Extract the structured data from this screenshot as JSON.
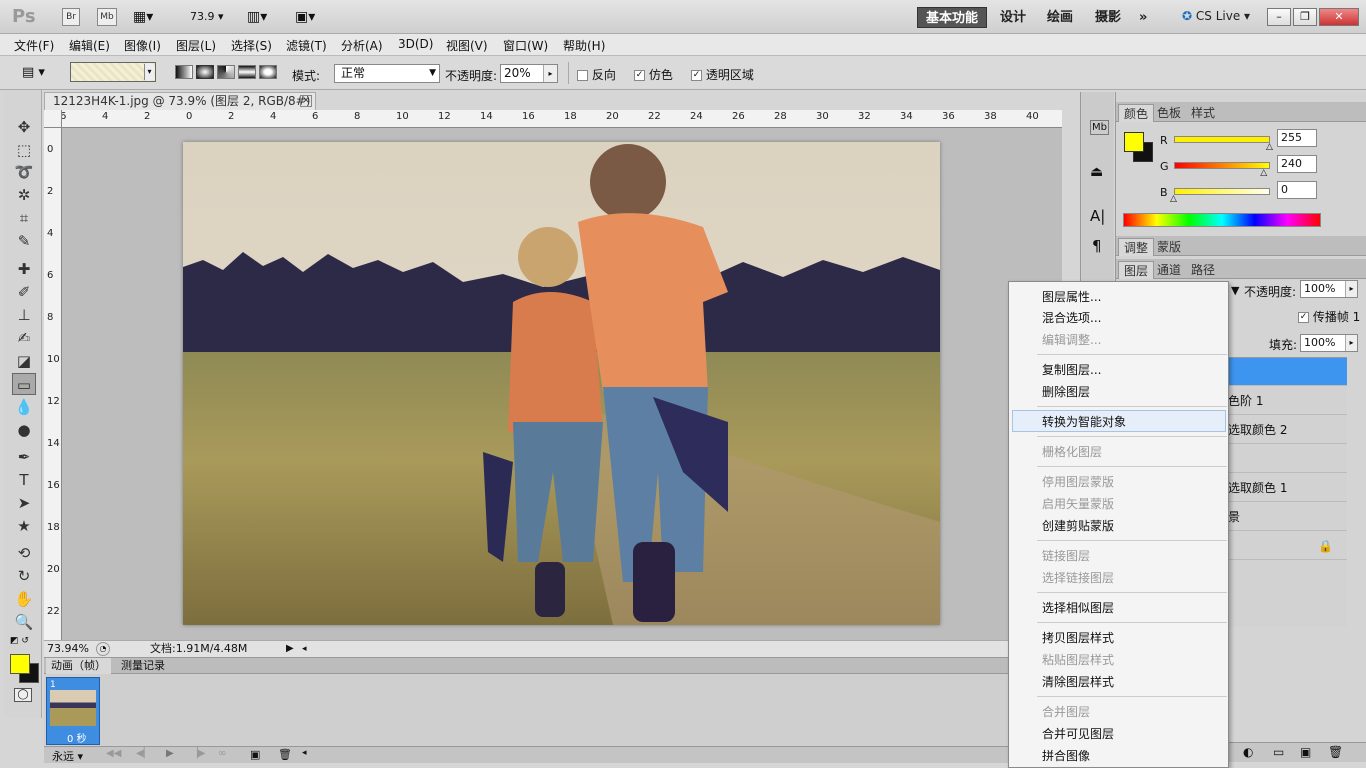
{
  "appbar": {
    "logo": "Ps",
    "br": "Br",
    "mb": "Mb",
    "zoom": "73.9",
    "workspaces": [
      "基本功能",
      "设计",
      "绘画",
      "摄影"
    ],
    "more": "»",
    "cslive": "CS Live"
  },
  "menu": [
    "文件(F)",
    "编辑(E)",
    "图像(I)",
    "图层(L)",
    "选择(S)",
    "滤镜(T)",
    "分析(A)",
    "3D(D)",
    "视图(V)",
    "窗口(W)",
    "帮助(H)"
  ],
  "options": {
    "mode_label": "模式:",
    "mode_value": "正常",
    "opacity_label": "不透明度:",
    "opacity_value": "20%",
    "reverse": "反向",
    "dither": "仿色",
    "transparency": "透明区域"
  },
  "document": {
    "tab_title": "12123H4K-1.jpg @ 73.9% (图层 2, RGB/8#) *",
    "zoom": "73.94%",
    "doc_info": "文档:1.91M/4.48M"
  },
  "ruler": {
    "h": [
      "6",
      "4",
      "2",
      "0",
      "2",
      "4",
      "6",
      "8",
      "10",
      "12",
      "14",
      "16",
      "18",
      "20",
      "22",
      "24",
      "26",
      "28",
      "30",
      "32",
      "34",
      "36",
      "38",
      "40"
    ],
    "v": [
      "0",
      "2",
      "4",
      "6",
      "8",
      "10",
      "12",
      "14",
      "16",
      "18",
      "20",
      "22"
    ]
  },
  "anim": {
    "tabs": [
      "动画（帧）",
      "测量记录"
    ],
    "frame_num": "1",
    "frame_time": "0 秒",
    "loop": "永远"
  },
  "colors": {
    "fg": "#ffff00",
    "bg": "#111111"
  },
  "color_panel": {
    "tabs": [
      "颜色",
      "色板",
      "样式"
    ],
    "r": "255",
    "g": "240",
    "b": "0",
    "r_frac": 1.0,
    "g_frac": 0.94,
    "b_frac": 0.0
  },
  "adjust_panel": {
    "tabs": [
      "调整",
      "蒙版"
    ]
  },
  "layers_panel": {
    "tabs": [
      "图层",
      "通道",
      "路径"
    ],
    "opacity_label": "不透明度:",
    "opacity": "100%",
    "propagate": "传播帧",
    "propagate_num": "1",
    "fill_label": "填充:",
    "fill": "100%",
    "rows": [
      "",
      "色阶 1",
      "选取颜色 2",
      "",
      "选取颜色 1",
      "景",
      ""
    ]
  },
  "context_menu": {
    "items": [
      {
        "label": "图层属性...",
        "enabled": true
      },
      {
        "label": "混合选项...",
        "enabled": true
      },
      {
        "label": "编辑调整...",
        "enabled": false
      },
      {
        "label": "复制图层...",
        "enabled": true
      },
      {
        "label": "删除图层",
        "enabled": true
      },
      {
        "label": "转换为智能对象",
        "enabled": true,
        "highlighted": true
      },
      {
        "label": "栅格化图层",
        "enabled": false
      },
      {
        "label": "停用图层蒙版",
        "enabled": false
      },
      {
        "label": "启用矢量蒙版",
        "enabled": false
      },
      {
        "label": "创建剪贴蒙版",
        "enabled": true
      },
      {
        "label": "链接图层",
        "enabled": false
      },
      {
        "label": "选择链接图层",
        "enabled": false
      },
      {
        "label": "选择相似图层",
        "enabled": true
      },
      {
        "label": "拷贝图层样式",
        "enabled": true
      },
      {
        "label": "粘贴图层样式",
        "enabled": false
      },
      {
        "label": "清除图层样式",
        "enabled": true
      },
      {
        "label": "合并图层",
        "enabled": false
      },
      {
        "label": "合并可见图层",
        "enabled": true
      },
      {
        "label": "拼合图像",
        "enabled": true
      }
    ]
  }
}
